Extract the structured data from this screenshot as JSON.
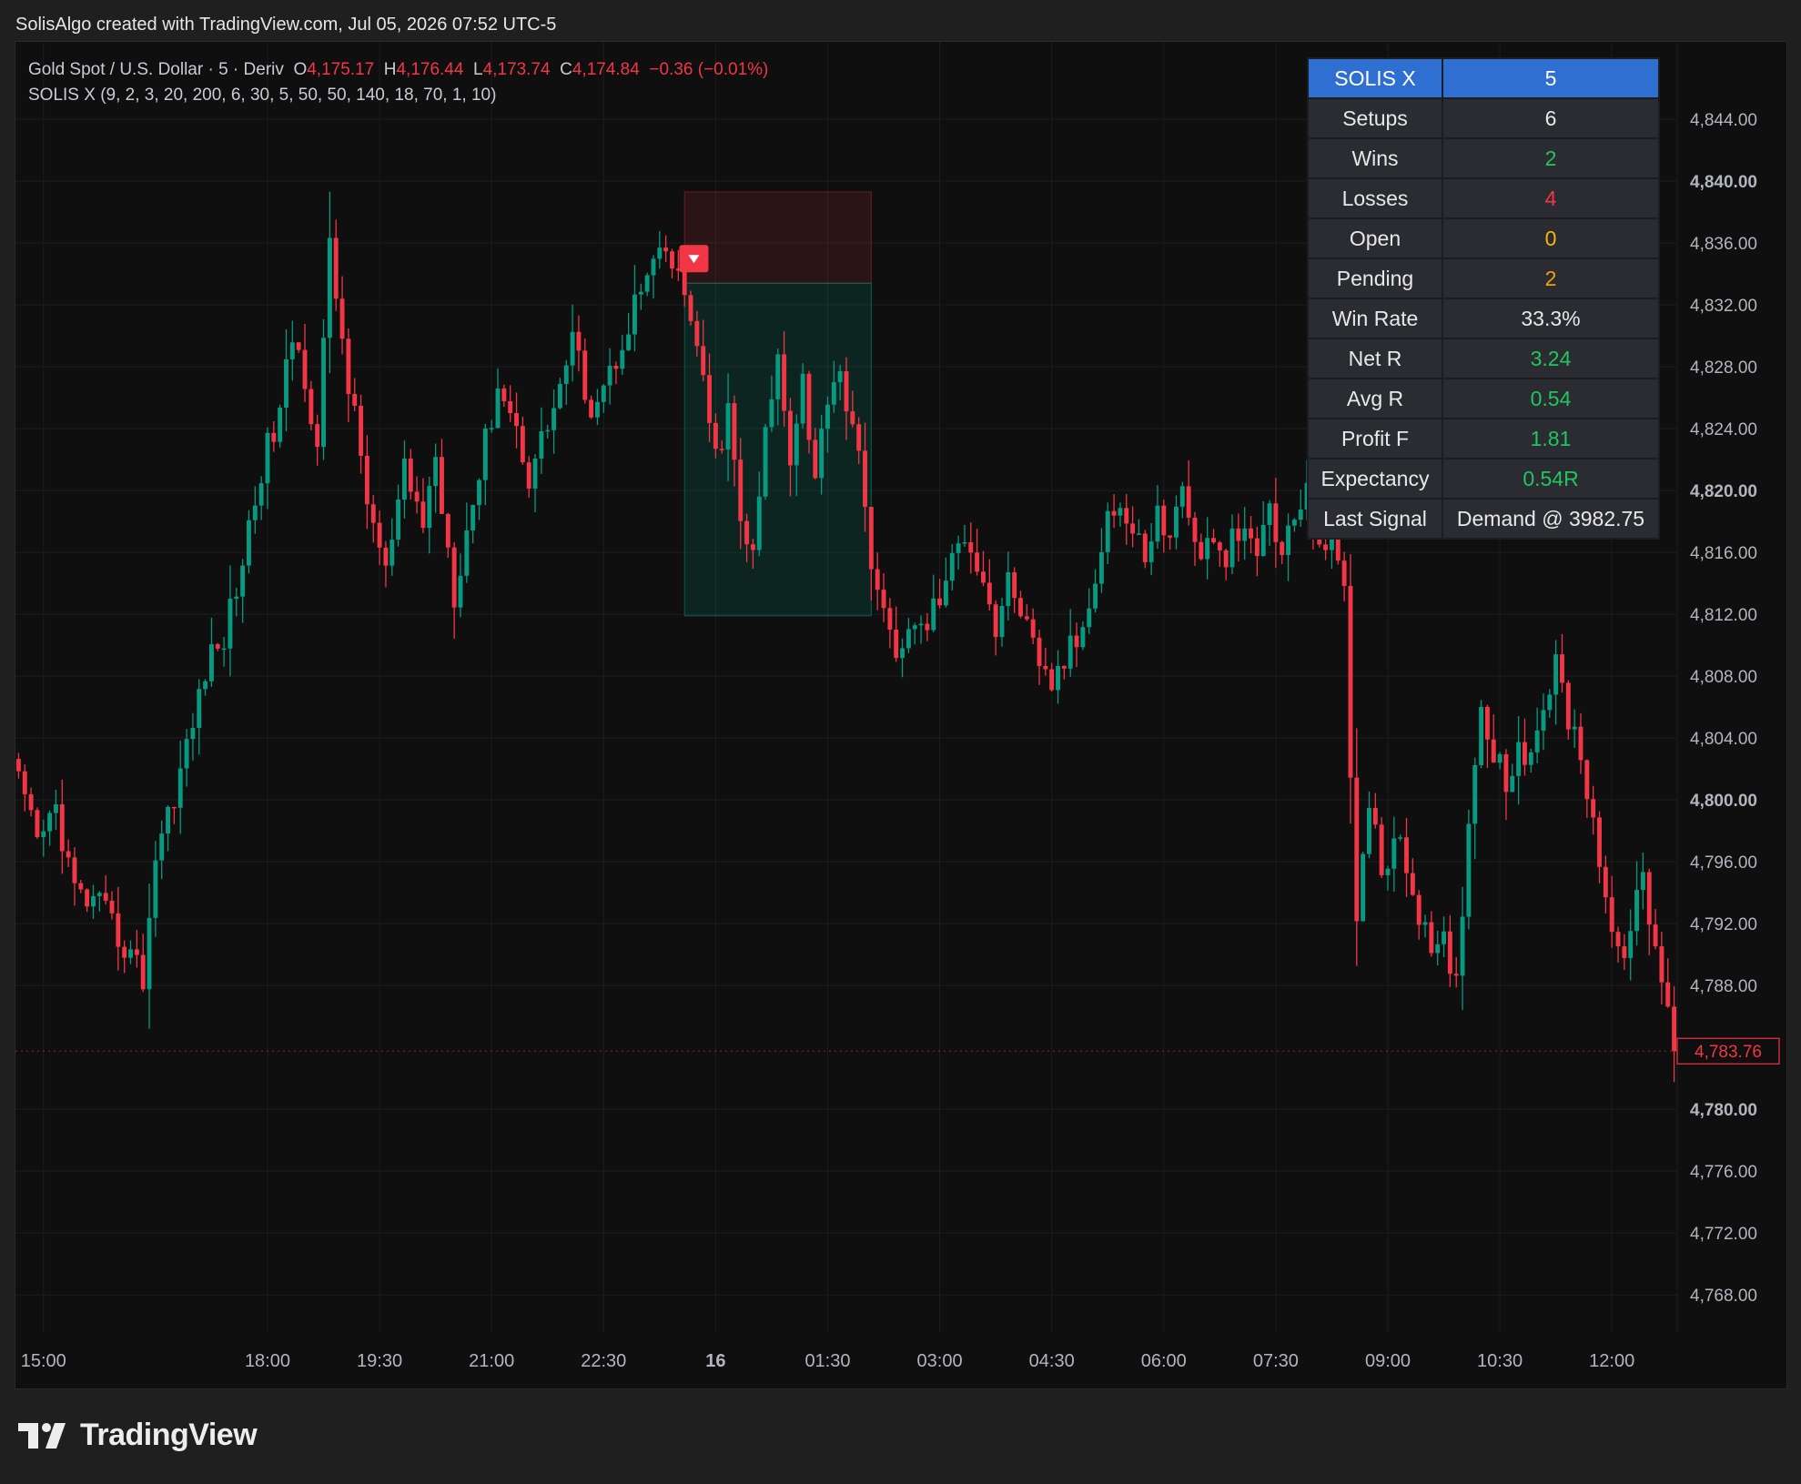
{
  "caption": "SolisAlgo created with TradingView.com, Jul 05, 2026 07:52 UTC-5",
  "legend": {
    "symbol": "Gold Spot / U.S. Dollar · 5 · Deriv",
    "o_label": "O",
    "o_value": "4,175.17",
    "h_label": "H",
    "h_value": "4,176.44",
    "l_label": "L",
    "l_value": "4,173.74",
    "c_label": "C",
    "c_value": "4,174.84",
    "change": "−0.36 (−0.01%)",
    "indicator": "SOLIS X (9, 2, 3, 20, 200, 6, 30, 5, 50, 50, 140, 18, 70, 1, 10)"
  },
  "stats_table": {
    "rows": [
      {
        "key": "SOLIS X",
        "value": "5",
        "color": "#ffffff"
      },
      {
        "key": "Setups",
        "value": "6",
        "color": "#e8e8e8"
      },
      {
        "key": "Wins",
        "value": "2",
        "color": "#22c55e"
      },
      {
        "key": "Losses",
        "value": "4",
        "color": "#f23645"
      },
      {
        "key": "Open",
        "value": "0",
        "color": "#f5b800"
      },
      {
        "key": "Pending",
        "value": "2",
        "color": "#f59e0b"
      },
      {
        "key": "Win Rate",
        "value": "33.3%",
        "color": "#e8e8e8"
      },
      {
        "key": "Net R",
        "value": "3.24",
        "color": "#22c55e"
      },
      {
        "key": "Avg R",
        "value": "0.54",
        "color": "#22c55e"
      },
      {
        "key": "Profit F",
        "value": "1.81",
        "color": "#22c55e"
      },
      {
        "key": "Expectancy",
        "value": "0.54R",
        "color": "#22c55e"
      },
      {
        "key": "Last Signal",
        "value": "Demand @ 3982.75",
        "color": "#e8e8e8"
      }
    ]
  },
  "footer": {
    "brand": "TradingView"
  },
  "colors": {
    "up": "#089981",
    "down": "#f23645",
    "background": "#0f0f0f",
    "grid": "#1d1d1d",
    "axis_text": "#b2b5be",
    "header": "#2f6fd1"
  },
  "chart_data": {
    "type": "candlestick",
    "title": "",
    "xlabel": "",
    "ylabel": "",
    "ylim": [
      4765.6,
      4849.0
    ],
    "y_ticks": [
      {
        "value": 4844,
        "label": "4,844.00",
        "bold": false
      },
      {
        "value": 4840,
        "label": "4,840.00",
        "bold": true
      },
      {
        "value": 4836,
        "label": "4,836.00",
        "bold": false
      },
      {
        "value": 4832,
        "label": "4,832.00",
        "bold": false
      },
      {
        "value": 4828,
        "label": "4,828.00",
        "bold": false
      },
      {
        "value": 4824,
        "label": "4,824.00",
        "bold": false
      },
      {
        "value": 4820,
        "label": "4,820.00",
        "bold": true
      },
      {
        "value": 4816,
        "label": "4,816.00",
        "bold": false
      },
      {
        "value": 4812,
        "label": "4,812.00",
        "bold": false
      },
      {
        "value": 4808,
        "label": "4,808.00",
        "bold": false
      },
      {
        "value": 4804,
        "label": "4,804.00",
        "bold": false
      },
      {
        "value": 4800,
        "label": "4,800.00",
        "bold": true
      },
      {
        "value": 4796,
        "label": "4,796.00",
        "bold": false
      },
      {
        "value": 4792,
        "label": "4,792.00",
        "bold": false
      },
      {
        "value": 4788,
        "label": "4,788.00",
        "bold": false
      },
      {
        "value": 4780,
        "label": "4,780.00",
        "bold": true
      },
      {
        "value": 4776,
        "label": "4,776.00",
        "bold": false
      },
      {
        "value": 4772,
        "label": "4,772.00",
        "bold": false
      },
      {
        "value": 4768,
        "label": "4,768.00",
        "bold": false
      }
    ],
    "x_ticks": [
      {
        "label": "15:00",
        "index": 4,
        "bold": false
      },
      {
        "label": "18:00",
        "index": 40,
        "bold": false
      },
      {
        "label": "19:30",
        "index": 58,
        "bold": false
      },
      {
        "label": "21:00",
        "index": 76,
        "bold": false
      },
      {
        "label": "22:30",
        "index": 94,
        "bold": false
      },
      {
        "label": "16",
        "index": 112,
        "bold": true
      },
      {
        "label": "01:30",
        "index": 130,
        "bold": false
      },
      {
        "label": "03:00",
        "index": 148,
        "bold": false
      },
      {
        "label": "04:30",
        "index": 166,
        "bold": false
      },
      {
        "label": "06:00",
        "index": 184,
        "bold": false
      },
      {
        "label": "07:30",
        "index": 202,
        "bold": false
      },
      {
        "label": "09:00",
        "index": 220,
        "bold": false
      },
      {
        "label": "10:30",
        "index": 238,
        "bold": false
      },
      {
        "label": "12:00",
        "index": 256,
        "bold": false
      }
    ],
    "x_range": [
      -0.5,
      266.5
    ],
    "last_price": {
      "value": 4783.76,
      "label": "4,783.76"
    },
    "setup_zone": {
      "start_index": 107,
      "end_index": 137,
      "stop_top": 4839.3,
      "entry": 4833.4,
      "target": 4811.9,
      "signal_index": 108.5
    },
    "close_points": [
      [
        0,
        4801.0
      ],
      [
        3,
        4797.0
      ],
      [
        6,
        4799.5
      ],
      [
        9,
        4794.0
      ],
      [
        13,
        4793.0
      ],
      [
        18,
        4790.0
      ],
      [
        20,
        4788.5
      ],
      [
        22,
        4796.5
      ],
      [
        25,
        4800.5
      ],
      [
        28,
        4804.8
      ],
      [
        30,
        4808.5
      ],
      [
        33,
        4810.5
      ],
      [
        36,
        4815.5
      ],
      [
        39,
        4821.5
      ],
      [
        42,
        4825.0
      ],
      [
        44,
        4830.0
      ],
      [
        46,
        4827.5
      ],
      [
        48,
        4823.0
      ],
      [
        50,
        4835.5
      ],
      [
        53,
        4827.0
      ],
      [
        56,
        4819.5
      ],
      [
        59,
        4814.5
      ],
      [
        62,
        4821.0
      ],
      [
        65,
        4818.0
      ],
      [
        67,
        4822.0
      ],
      [
        70,
        4813.5
      ],
      [
        72,
        4817.5
      ],
      [
        75,
        4823.0
      ],
      [
        77,
        4827.0
      ],
      [
        80,
        4824.0
      ],
      [
        82,
        4821.0
      ],
      [
        86,
        4825.5
      ],
      [
        89,
        4829.5
      ],
      [
        92,
        4825.5
      ],
      [
        95,
        4827.5
      ],
      [
        98,
        4831.0
      ],
      [
        101,
        4833.8
      ],
      [
        104,
        4835.3
      ],
      [
        106,
        4833.5
      ],
      [
        108,
        4831.5
      ],
      [
        110,
        4826.5
      ],
      [
        112,
        4822.0
      ],
      [
        114,
        4825.0
      ],
      [
        116,
        4818.0
      ],
      [
        118,
        4815.5
      ],
      [
        120,
        4823.5
      ],
      [
        122,
        4828.5
      ],
      [
        124,
        4822.5
      ],
      [
        126,
        4827.5
      ],
      [
        128,
        4820.5
      ],
      [
        130,
        4826.5
      ],
      [
        132,
        4828.0
      ],
      [
        134,
        4823.5
      ],
      [
        136,
        4820.0
      ],
      [
        137,
        4815.0
      ],
      [
        139,
        4811.5
      ],
      [
        141,
        4810.0
      ],
      [
        143,
        4810.5
      ],
      [
        146,
        4811.5
      ],
      [
        149,
        4814.0
      ],
      [
        152,
        4817.5
      ],
      [
        155,
        4814.5
      ],
      [
        157,
        4811.0
      ],
      [
        159,
        4814.0
      ],
      [
        161,
        4812.5
      ],
      [
        164,
        4808.0
      ],
      [
        166,
        4807.5
      ],
      [
        168,
        4809.0
      ],
      [
        171,
        4811.0
      ],
      [
        173,
        4815.0
      ],
      [
        175,
        4818.5
      ],
      [
        177,
        4819.0
      ],
      [
        179,
        4817.0
      ],
      [
        181,
        4816.0
      ],
      [
        183,
        4818.5
      ],
      [
        185,
        4816.5
      ],
      [
        187,
        4821.0
      ],
      [
        189,
        4816.0
      ],
      [
        191,
        4816.5
      ],
      [
        193,
        4815.5
      ],
      [
        196,
        4817.0
      ],
      [
        199,
        4816.0
      ],
      [
        201,
        4819.0
      ],
      [
        203,
        4815.5
      ],
      [
        205,
        4818.5
      ],
      [
        207,
        4819.5
      ],
      [
        209,
        4817.0
      ],
      [
        211,
        4816.0
      ],
      [
        213,
        4814.0
      ],
      [
        214,
        4802.0
      ],
      [
        215,
        4793.0
      ],
      [
        217,
        4799.5
      ],
      [
        219,
        4795.5
      ],
      [
        221,
        4797.5
      ],
      [
        223,
        4795.5
      ],
      [
        225,
        4793.0
      ],
      [
        227,
        4789.5
      ],
      [
        229,
        4790.5
      ],
      [
        231,
        4788.0
      ],
      [
        233,
        4799.0
      ],
      [
        235,
        4806.0
      ],
      [
        237,
        4803.5
      ],
      [
        239,
        4801.0
      ],
      [
        241,
        4804.0
      ],
      [
        243,
        4802.0
      ],
      [
        245,
        4806.5
      ],
      [
        247,
        4808.5
      ],
      [
        249,
        4805.5
      ],
      [
        251,
        4803.0
      ],
      [
        253,
        4799.0
      ],
      [
        255,
        4793.5
      ],
      [
        257,
        4789.5
      ],
      [
        259,
        4792.0
      ],
      [
        261,
        4794.5
      ],
      [
        263,
        4790.5
      ],
      [
        265,
        4786.0
      ],
      [
        266,
        4783.8
      ]
    ]
  }
}
